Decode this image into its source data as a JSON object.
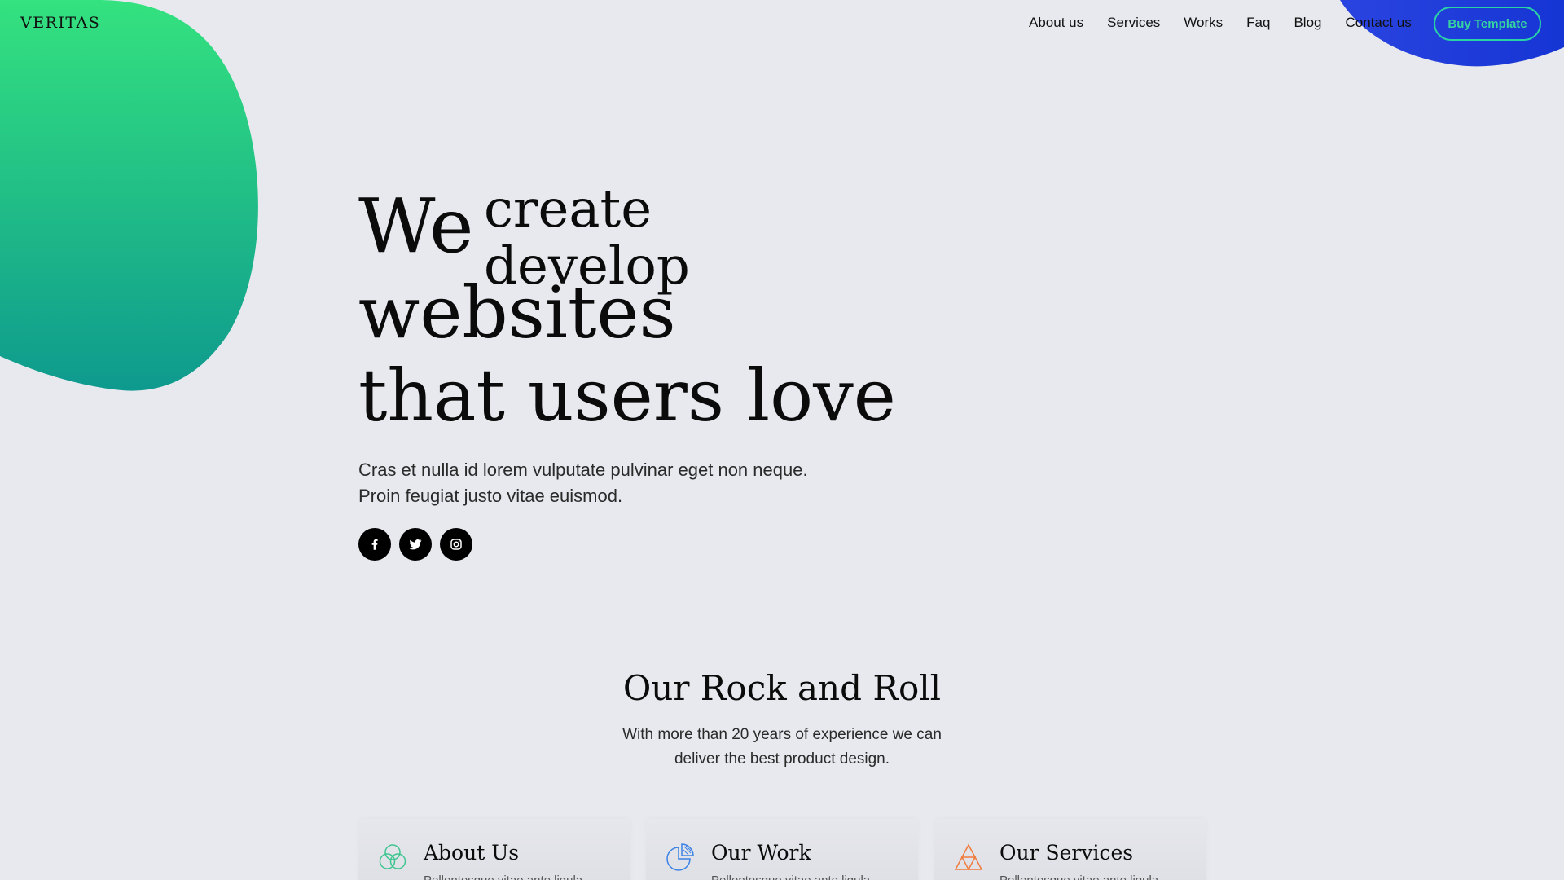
{
  "brand": {
    "logo": "VERITAS"
  },
  "nav": {
    "items": [
      "About us",
      "Services",
      "Works",
      "Faq",
      "Blog",
      "Contact us"
    ],
    "buy_label": "Buy Template"
  },
  "hero": {
    "prefix": "We",
    "rotating_words": [
      "create",
      "develop"
    ],
    "line1": "websites",
    "line2": "that users love",
    "description": "Cras et nulla id lorem vulputate pulvinar eget non neque. Proin feugiat justo vitae euismod."
  },
  "socials": [
    "facebook-icon",
    "twitter-icon",
    "instagram-icon"
  ],
  "section": {
    "title": "Our Rock and Roll",
    "subtitle": "With more than 20 years of experience we can deliver the best product design."
  },
  "cards": [
    {
      "title": "About Us",
      "text": "Pellentesque vitae ante ligula",
      "icon": "circles-icon",
      "color": "#3cc58f"
    },
    {
      "title": "Our Work",
      "text": "Pellentesque vitae ante ligula",
      "icon": "pie-chart-icon",
      "color": "#3b82e6"
    },
    {
      "title": "Our Services",
      "text": "Pellentesque vitae ante ligula",
      "icon": "triangle-icon",
      "color": "#f07a3c"
    }
  ],
  "colors": {
    "background": "#e8e9ee",
    "green_blob_top": "#34e27f",
    "green_blob_bottom": "#0e9a8e",
    "blue_blob": "#1537d8",
    "accent": "#2ad3a6"
  }
}
